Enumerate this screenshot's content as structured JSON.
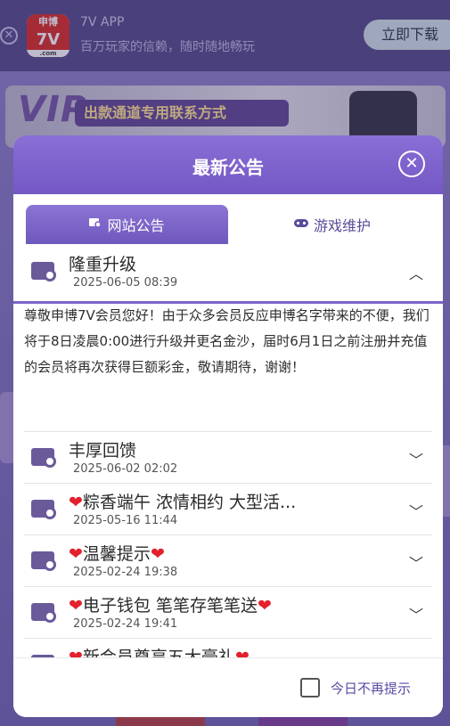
{
  "appbar": {
    "logo_top": "申博",
    "logo_mid": "7V",
    "logo_bot": ".com",
    "name": "7V APP",
    "slogan": "百万玩家的信赖，随时随地畅玩",
    "download_label": "立即下载",
    "close_glyph": "✕"
  },
  "background": {
    "vip_text": "VIP",
    "vip_strip": "出款通道专用联系方式"
  },
  "modal": {
    "title": "最新公告",
    "close_glyph": "✕",
    "tabs": [
      {
        "label": "网站公告",
        "icon": "announcement-icon",
        "active": true
      },
      {
        "label": "游戏维护",
        "icon": "gamepad-icon",
        "active": false
      }
    ],
    "items": [
      {
        "title": "隆重升级",
        "date": "2025-06-05 08:39",
        "expanded": true,
        "body": "尊敬申博7V会员您好！由于众多会员反应申博名字带来的不便，我们将于8日凌晨0:00进行升级并更名金沙，届时6月1日之前注册并充值的会员将再次获得巨额彩金，敬请期待，谢谢！"
      },
      {
        "title": "丰厚回馈",
        "date": "2025-06-02 02:02",
        "expanded": false
      },
      {
        "title": "粽香端午 浓情相约 大型活...",
        "date": "2025-05-16 11:44",
        "expanded": false,
        "heart_left": true
      },
      {
        "title": "温馨提示",
        "date": "2025-02-24 19:38",
        "expanded": false,
        "heart_left": true,
        "heart_right": true
      },
      {
        "title": "电子钱包 笔笔存笔笔送",
        "date": "2025-02-24 19:41",
        "expanded": false,
        "heart_left": true,
        "heart_right": true
      },
      {
        "title": "新会员尊享五大豪礼",
        "date": "",
        "expanded": false,
        "heart_left": true,
        "heart_right": true
      }
    ],
    "footer_label": "今日不再提示"
  },
  "colors": {
    "header_purple": "#7457c4",
    "heart_red": "#e3202c",
    "footer_text": "#5b4aa5"
  }
}
